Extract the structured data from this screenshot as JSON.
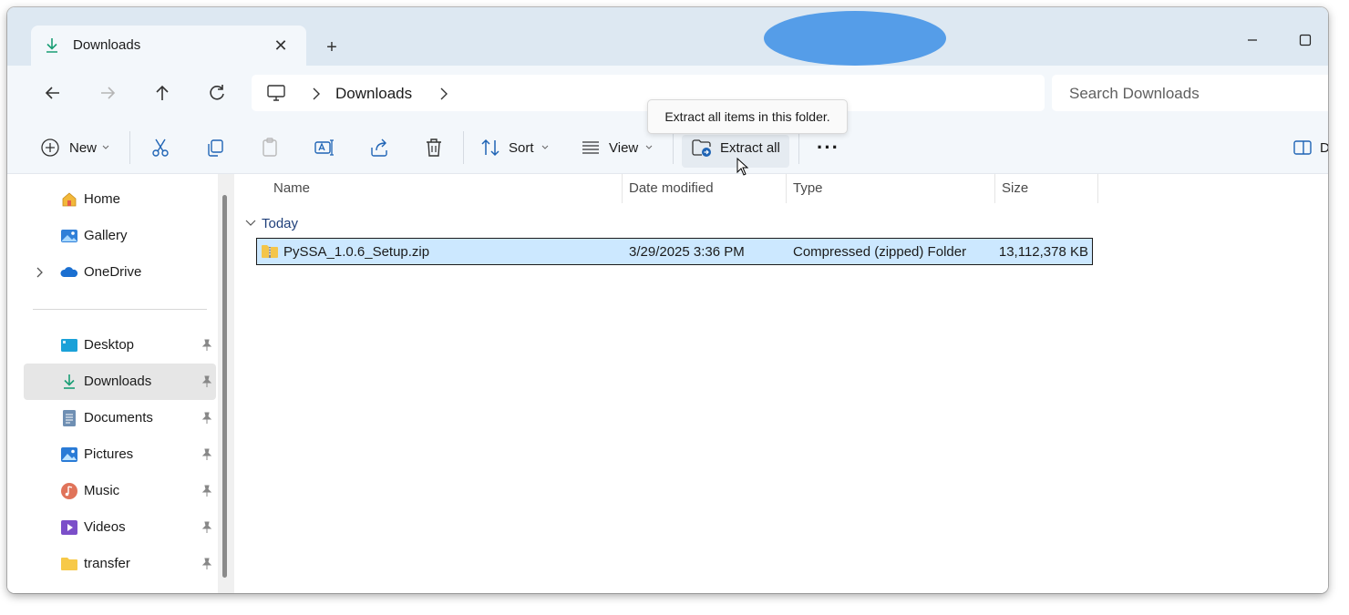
{
  "window": {
    "tab_title": "Downloads",
    "new_tab_symbol": "+",
    "close_symbol": "✕"
  },
  "address": {
    "breadcrumb": "Downloads",
    "search_placeholder": "Search Downloads"
  },
  "toolbar": {
    "new_label": "New",
    "sort_label": "Sort",
    "view_label": "View",
    "extract_label": "Extract all",
    "details_label": "D",
    "more_symbol": "···",
    "tooltip": "Extract all items in this folder."
  },
  "sidebar": {
    "top_items": [
      {
        "label": "Home",
        "icon": "home-icon"
      },
      {
        "label": "Gallery",
        "icon": "gallery-icon"
      },
      {
        "label": "OneDrive",
        "icon": "cloud-icon"
      }
    ],
    "pinned_items": [
      {
        "label": "Desktop",
        "icon": "desktop-icon"
      },
      {
        "label": "Downloads",
        "icon": "download-icon",
        "selected": true
      },
      {
        "label": "Documents",
        "icon": "documents-icon"
      },
      {
        "label": "Pictures",
        "icon": "pictures-icon"
      },
      {
        "label": "Music",
        "icon": "music-icon"
      },
      {
        "label": "Videos",
        "icon": "videos-icon"
      },
      {
        "label": "transfer",
        "icon": "folder-icon"
      }
    ]
  },
  "table": {
    "columns": [
      "Name",
      "Date modified",
      "Type",
      "Size"
    ],
    "group_label": "Today",
    "rows": [
      {
        "name": "PySSA_1.0.6_Setup.zip",
        "date_modified": "3/29/2025 3:36 PM",
        "type": "Compressed (zipped) Folder",
        "size": "13,112,378 KB",
        "selected": true
      }
    ]
  },
  "colors": {
    "accent": "#0f6cbd",
    "selection": "#cce8ff",
    "chrome": "#f3f7fb",
    "download_green": "#1a9e75"
  }
}
